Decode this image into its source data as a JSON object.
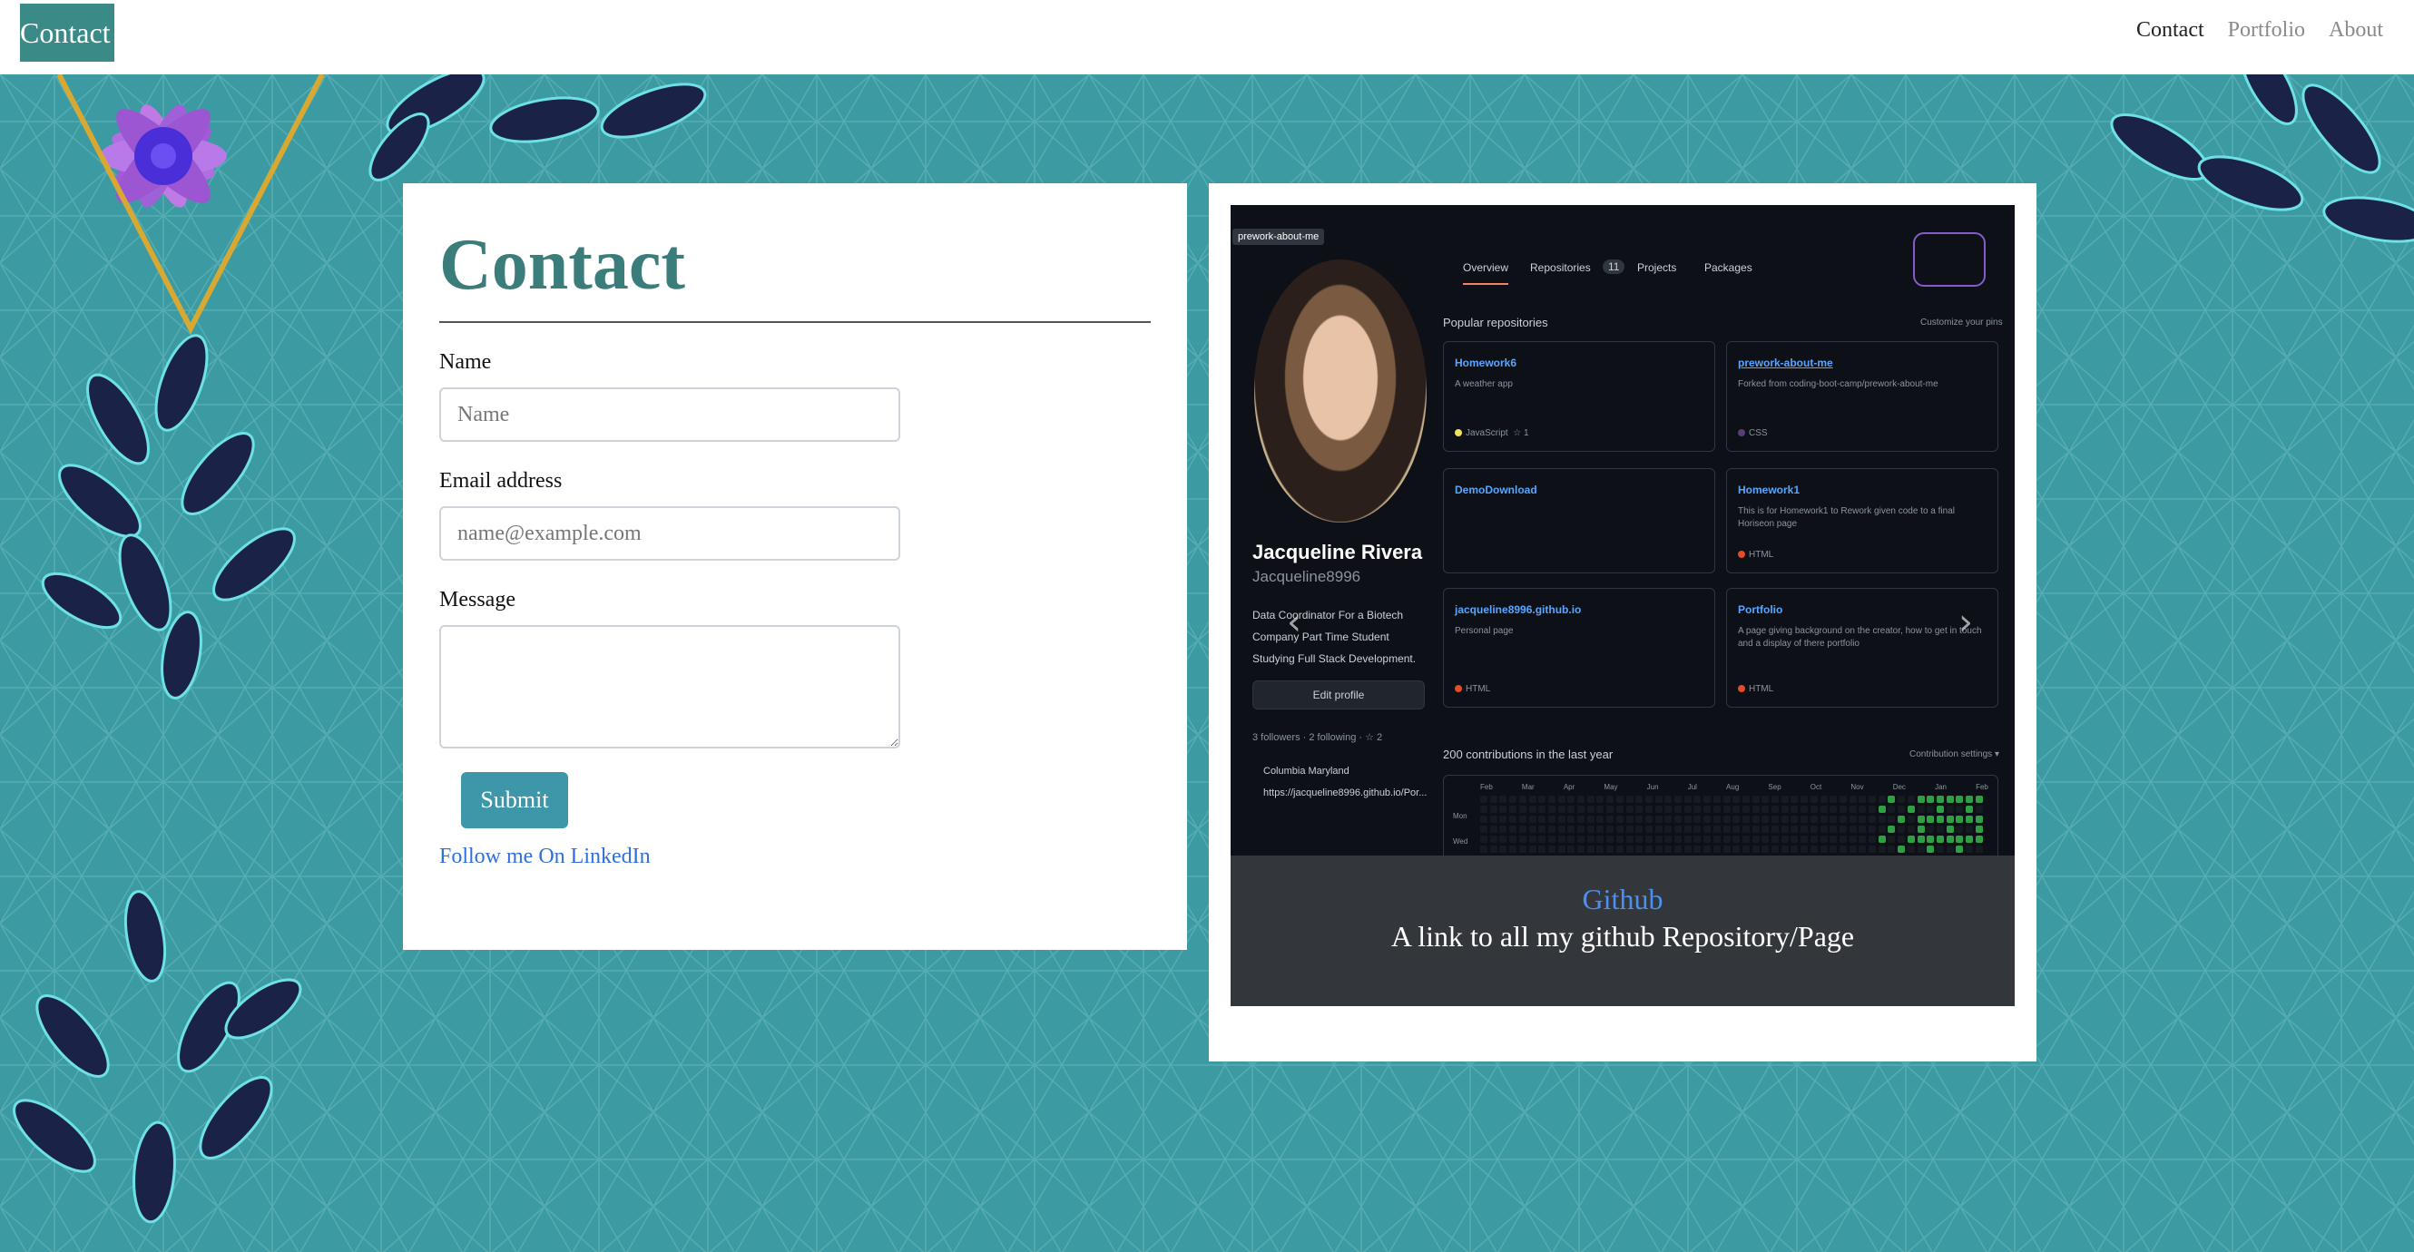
{
  "navbar": {
    "brand": "Contact",
    "links": [
      {
        "label": "Contact",
        "active": true
      },
      {
        "label": "Portfolio",
        "active": false
      },
      {
        "label": "About",
        "active": false
      }
    ]
  },
  "contact": {
    "title": "Contact",
    "name_label": "Name",
    "name_placeholder": "Name",
    "email_label": "Email address",
    "email_placeholder": "name@example.com",
    "message_label": "Message",
    "submit_label": "Submit",
    "linkedin_label": "Follow me On LinkedIn"
  },
  "carousel": {
    "caption_title": "Github",
    "caption_text": "A link to all my github Repository/Page",
    "prev_icon": "chevron-left-icon",
    "next_icon": "chevron-right-icon"
  },
  "github_shot": {
    "badge": "prework-about-me",
    "tabs": [
      "Overview",
      "Repositories",
      "11",
      "Projects",
      "Packages"
    ],
    "profile_name": "Jacqueline Rivera",
    "profile_user": "Jacqueline8996",
    "bio": "Data Coordinator For a Biotech Company Part Time Student Studying Full Stack Development.",
    "edit_profile": "Edit profile",
    "followers": "3 followers · 2 following · ☆ 2",
    "location": "Columbia Maryland",
    "website": "https://jacqueline8996.github.io/Por...",
    "popular_label": "Popular repositories",
    "customize_label": "Customize your pins",
    "contrib_label": "200 contributions in the last year",
    "contrib_settings": "Contribution settings ▾",
    "repos": [
      {
        "name": "Homework6",
        "desc": "A weather app",
        "lang": "JavaScript",
        "stars": "☆ 1",
        "color": "#f1e05a"
      },
      {
        "name": "prework-about-me",
        "desc": "Forked from coding-boot-camp/prework-about-me",
        "lang": "CSS",
        "stars": "",
        "color": "#563d7c"
      },
      {
        "name": "DemoDownload",
        "desc": "",
        "lang": "",
        "stars": "",
        "color": ""
      },
      {
        "name": "Homework1",
        "desc": "This is for Homework1 to Rework given code to a final Horiseon page",
        "lang": "HTML",
        "stars": "",
        "color": "#e34c26"
      },
      {
        "name": "jacqueline8996.github.io",
        "desc": "Personal page",
        "lang": "HTML",
        "stars": "",
        "color": "#e34c26"
      },
      {
        "name": "Portfolio",
        "desc": "A page giving background on the creator, how to get in touch and a display of there portfolio",
        "lang": "HTML",
        "stars": "",
        "color": "#e34c26"
      }
    ],
    "months": [
      "Feb",
      "Mar",
      "Apr",
      "May",
      "Jun",
      "Jul",
      "Aug",
      "Sep",
      "Oct",
      "Nov",
      "Dec",
      "Jan",
      "Feb"
    ],
    "day_labels": [
      "Mon",
      "Wed"
    ]
  },
  "colors": {
    "background": "#3b9aa2",
    "accent": "#3a7d7a",
    "button": "#3e97a8",
    "link": "#2f6fdb"
  }
}
